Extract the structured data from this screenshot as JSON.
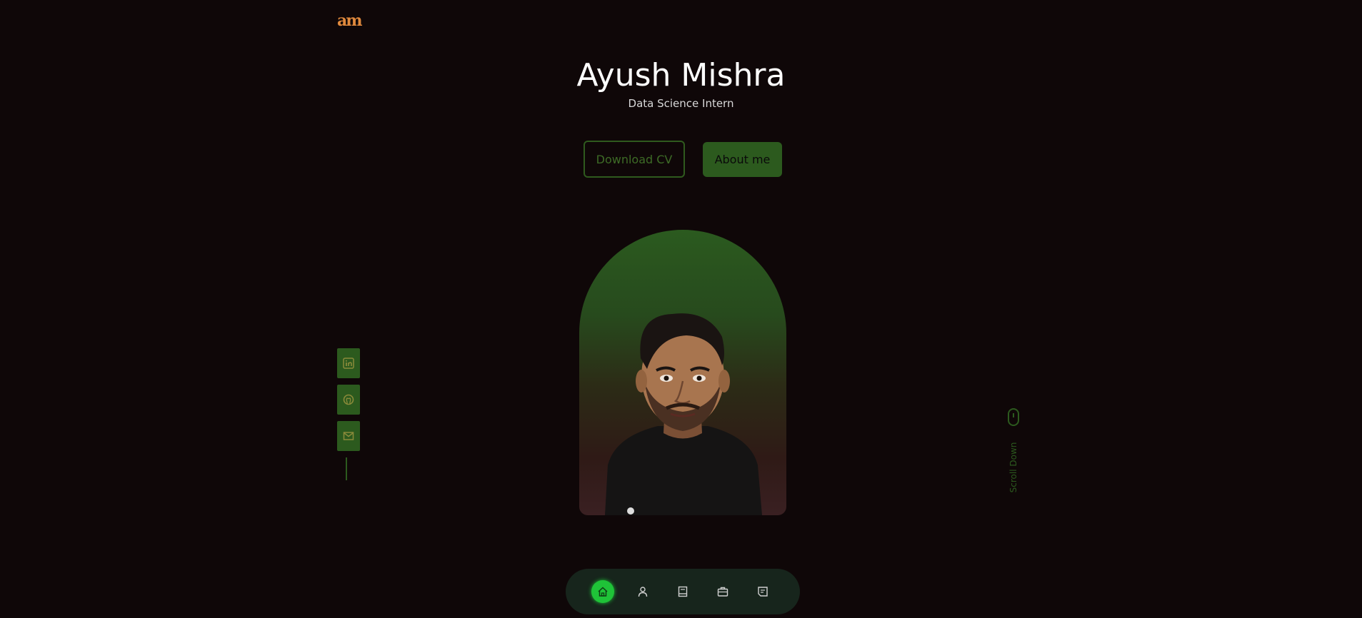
{
  "logo": {
    "text": "am"
  },
  "hero": {
    "name": "Ayush Mishra",
    "role": "Data Science Intern"
  },
  "buttons": {
    "download_cv": "Download CV",
    "about_me": "About me"
  },
  "socials": [
    {
      "icon": "linkedin-icon"
    },
    {
      "icon": "github-icon"
    },
    {
      "icon": "mail-icon"
    }
  ],
  "scroll": {
    "label": "Scroll Down"
  },
  "nav": {
    "items": [
      {
        "icon": "home-icon",
        "active": true
      },
      {
        "icon": "user-icon",
        "active": false
      },
      {
        "icon": "book-icon",
        "active": false
      },
      {
        "icon": "briefcase-icon",
        "active": false
      },
      {
        "icon": "message-icon",
        "active": false
      }
    ]
  },
  "colors": {
    "background": "#0f0708",
    "accent": "#2c5a1e",
    "active_nav": "#1fc338",
    "logo": "#e0893d"
  }
}
